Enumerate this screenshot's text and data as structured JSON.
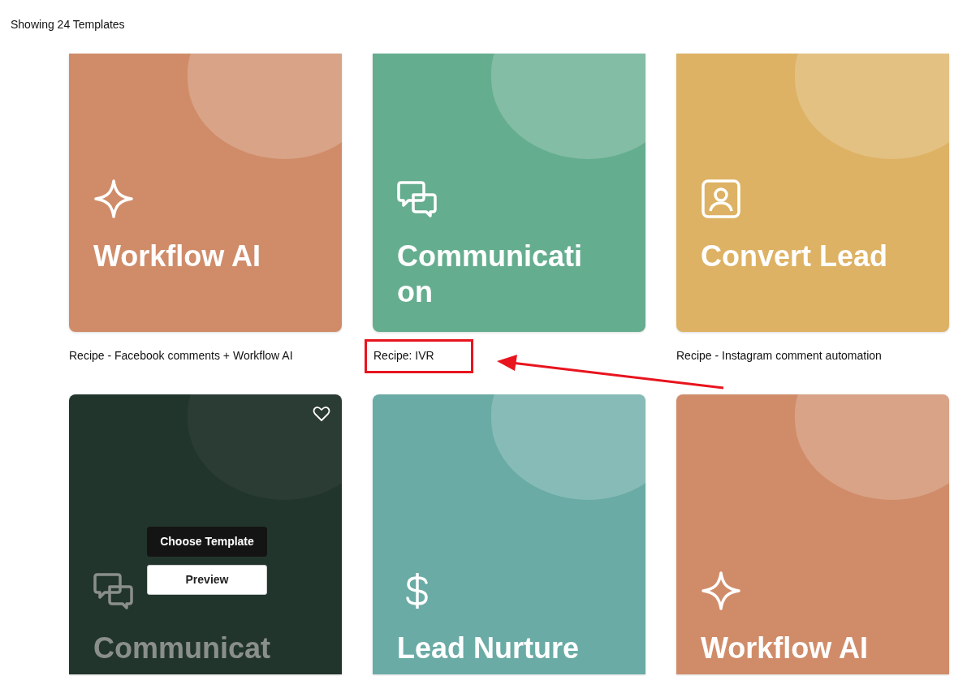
{
  "results_label": "Showing 24 Templates",
  "templates": [
    {
      "title": "Workflow AI",
      "kind": "sparkle",
      "color": "#d08c69",
      "caption": "Recipe - Facebook comments + Workflow AI",
      "hovered": false,
      "highlighted": false
    },
    {
      "title": "Communication",
      "kind": "chat",
      "color": "#65ad8f",
      "caption": "Recipe: IVR",
      "hovered": false,
      "highlighted": true
    },
    {
      "title": "Convert Lead",
      "kind": "contact",
      "color": "#ddb264",
      "caption": "Recipe - Instagram comment automation",
      "hovered": false,
      "highlighted": false
    },
    {
      "title": "Communicat",
      "kind": "chat",
      "color": "#22352c",
      "hovered": true,
      "actions": [
        "Choose Template",
        "Preview"
      ]
    },
    {
      "title": "Lead Nurture",
      "kind": "dollar",
      "color": "#6aaba5",
      "hovered": false
    },
    {
      "title": "Workflow AI",
      "kind": "sparkle",
      "color": "#d08c69",
      "hovered": false
    }
  ]
}
